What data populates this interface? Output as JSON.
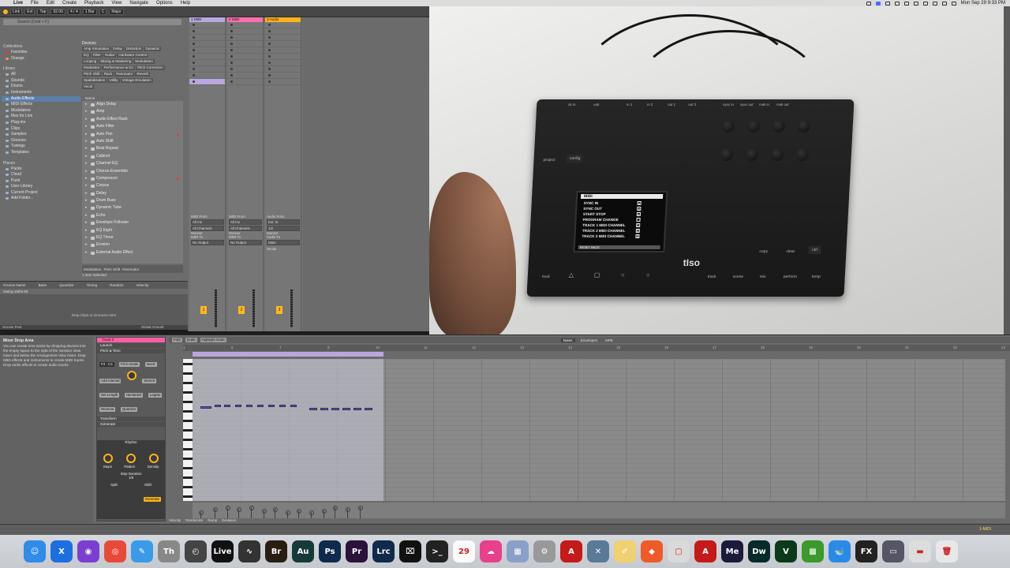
{
  "menubar": {
    "items": [
      "Live",
      "File",
      "Edit",
      "Create",
      "Playback",
      "View",
      "Navigate",
      "Options",
      "Help"
    ],
    "clock": "Mon Sep 29  9:33 PM"
  },
  "ctrlbar": {
    "link": "Link",
    "ext": "Ext",
    "tap": "Tap",
    "bpm": "92.00",
    "sig": "4 / 4",
    "bar": "1 Bar",
    "key": "C",
    "scale": "Major"
  },
  "browser": {
    "search_placeholder": "Search (Cmd + F)",
    "collections_h": "Collections",
    "collections": [
      {
        "label": "Favorites",
        "cls": "red"
      },
      {
        "label": "Orange",
        "cls": "orange"
      }
    ],
    "library_h": "Library",
    "library": [
      "All",
      "Sounds",
      "Drums",
      "Instruments",
      "Audio Effects",
      "MIDI Effects",
      "Modulators",
      "Max for Live",
      "Plug-ins",
      "Clips",
      "Samples",
      "Grooves",
      "Tunings",
      "Templates"
    ],
    "places_h": "Places",
    "places": [
      "Packs",
      "Cloud",
      "Push",
      "User Library",
      "Current Project",
      "Add Folder..."
    ],
    "devices_h": "Devices",
    "tags": [
      [
        "Amp Simulation",
        "Delay",
        "Distortion",
        "Dynamic"
      ],
      [
        "EQ",
        "Filter",
        "Guitar",
        "Hardware Control"
      ],
      [
        "Looping",
        "Mixing & Mastering",
        "Modulation"
      ],
      [
        "Modulator",
        "Performance & DJ",
        "Pitch Correction"
      ],
      [
        "Pitch Shift",
        "Rack",
        "Resonator",
        "Reverb"
      ],
      [
        "Spatialization",
        "Utility",
        "Vintage Emulation"
      ],
      [
        "Vocal"
      ]
    ],
    "name_h": "Name",
    "effects": [
      "Align Delay",
      "Amp",
      "Audio Effect Rack",
      "Auto Filter",
      "Auto Pan",
      "Auto Shift",
      "Beat Repeat",
      "Cabinet",
      "Channel EQ",
      "Chorus-Ensemble",
      "Compressor",
      "Corpus",
      "Delay",
      "Drum Buss",
      "Dynamic Tube",
      "Echo",
      "Envelope Follower",
      "EQ Eight",
      "EQ Three",
      "Erosion",
      "External Audio Effect"
    ],
    "footer_tags": [
      "Modulation",
      "Pitch Shift",
      "Resonator"
    ],
    "status": "1 item selected"
  },
  "groove": {
    "headers": [
      "Groove Name",
      "Base",
      "Quantize",
      "Timing",
      "Random",
      "Velocity"
    ],
    "row": "Swing 16ths 66",
    "drop": "Drop Clips or Grooves Here",
    "pool": "Groove Pool",
    "global": "Global Amount"
  },
  "session": {
    "tracks": [
      {
        "title": "1 MIDI",
        "color": "#b9a7de",
        "num": "1"
      },
      {
        "title": "2 MIDI",
        "color": "#ff6fb0",
        "num": "2"
      },
      {
        "title": "3 Audio",
        "color": "#ffb21a",
        "num": "3"
      }
    ],
    "io_labels": [
      "MIDI From",
      "All Ins",
      "All Channels",
      "Monitor",
      "MIDI To",
      "No Output"
    ],
    "audio_io": [
      "Audio From",
      "Ext. In",
      "1/2",
      "Monitor",
      "Audio To",
      "Main"
    ],
    "sends": "Sends"
  },
  "device_video": {
    "ports": [
      "dc in",
      "usb",
      "in 1",
      "in 2",
      "out 1",
      "out 2",
      "sync in",
      "sync out",
      "midi in",
      "midi out"
    ],
    "screen_title": "MIDI",
    "screen_lines": [
      {
        "label": "SYNC IN",
        "val": "x"
      },
      {
        "label": "SYNC OUT",
        "val": "x"
      },
      {
        "label": "START STOP",
        "val": "x"
      },
      {
        "label": "PROGRAM CHANGE",
        "val": ""
      },
      {
        "label": "TRACK 1 MIDI CHANNEL",
        "val": "1"
      },
      {
        "label": "TRACK 2 MIDI CHANNEL",
        "val": "2"
      },
      {
        "label": "TRACK 3 MIDI CHANNEL",
        "val": "3"
      }
    ],
    "screen_footer": "RESET          BACK",
    "buttons": [
      "project",
      "config",
      "mod",
      "track",
      "scene",
      "mix",
      "perform",
      "temp",
      "copy",
      "clear",
      "ctrl"
    ],
    "brand": "tIso"
  },
  "detail": {
    "info_title": "Mixer Drop Area",
    "info_body": "You can create new tracks by dropping devices into the empty space to the right of the Session View mixer and below the Arrangement View mixer. Drop MIDI effects and instruments to create MIDI tracks. Drop audio effects to create audio tracks.",
    "clip_name": "Track 0",
    "sections": [
      "Launch",
      "Pitch & Time"
    ],
    "pitch": "F3 - C4",
    "buttons": [
      "Fit to Scale",
      "Invert",
      "Add Interval",
      "Stretch",
      "Set Length",
      "Humanize",
      "Legato",
      "Reverse",
      "Quantize"
    ],
    "transform": "Transform",
    "generate": "Generate",
    "rhythm": "Rhythm",
    "knob_labels": [
      "Steps",
      "Pattern",
      "Density"
    ],
    "step_duration": "Step Duration",
    "step_val": "1/8",
    "gen_footer": [
      "Split",
      "Shift"
    ],
    "fold": "Fold",
    "scale": "Scale",
    "highlight": "Highlight Scale",
    "tabs": [
      "Notes",
      "Envelopes",
      "MPE"
    ],
    "ruler": [
      "1",
      "5",
      "7",
      "9",
      "10",
      "11",
      "12",
      "13",
      "14",
      "15",
      "16",
      "17",
      "18",
      "19",
      "20",
      "21",
      "22",
      "23"
    ],
    "vel_foot": [
      "Velocity",
      "Randomize",
      "Ramp",
      "Deviation"
    ],
    "generate_btn": "Generate",
    "status_right": "1-MIDI"
  },
  "dock": {
    "apps": [
      {
        "name": "finder",
        "label": "☺",
        "color": "#2f8ce8"
      },
      {
        "name": "xcode",
        "label": "X",
        "color": "#1b6fe0"
      },
      {
        "name": "obs",
        "label": "◉",
        "color": "#7a3fd0"
      },
      {
        "name": "chrome",
        "label": "◎",
        "color": "#e84a3a"
      },
      {
        "name": "stylus",
        "label": "✎",
        "color": "#3a9be8"
      },
      {
        "name": "type",
        "label": "Th",
        "color": "#888"
      },
      {
        "name": "capture",
        "label": "◴",
        "color": "#444"
      },
      {
        "name": "live",
        "label": "Live",
        "color": "#111"
      },
      {
        "name": "waves",
        "label": "∿",
        "color": "#333"
      },
      {
        "name": "bridge",
        "label": "Br",
        "color": "#2a1d12"
      },
      {
        "name": "audition",
        "label": "Au",
        "color": "#163a3a"
      },
      {
        "name": "photoshop",
        "label": "Ps",
        "color": "#0f2a4a"
      },
      {
        "name": "premiere",
        "label": "Pr",
        "color": "#2a123a"
      },
      {
        "name": "lightroom",
        "label": "Lrc",
        "color": "#0f2a4a"
      },
      {
        "name": "capcut",
        "label": "⌧",
        "color": "#111"
      },
      {
        "name": "terminal",
        "label": ">_",
        "color": "#222"
      },
      {
        "name": "calendar",
        "label": "29",
        "color": "#fafafa"
      },
      {
        "name": "creativecloud",
        "label": "☁",
        "color": "#e8408a"
      },
      {
        "name": "launchpad",
        "label": "▦",
        "color": "#8aa0c8"
      },
      {
        "name": "settings",
        "label": "⚙",
        "color": "#999"
      },
      {
        "name": "acrobat",
        "label": "A",
        "color": "#c41a1a"
      },
      {
        "name": "xquartz",
        "label": "✕",
        "color": "#5a7a9a"
      },
      {
        "name": "notes",
        "label": "✐",
        "color": "#f0d070"
      },
      {
        "name": "brave",
        "label": "◆",
        "color": "#f05a28"
      },
      {
        "name": "preview",
        "label": "▢",
        "color": "#dadada"
      },
      {
        "name": "acrobat2",
        "label": "A",
        "color": "#c41a1a"
      },
      {
        "name": "media-encoder",
        "label": "Me",
        "color": "#1a1a3a"
      },
      {
        "name": "dreamweaver",
        "label": "Dw",
        "color": "#072a2a"
      },
      {
        "name": "vectorworks",
        "label": "V",
        "color": "#0a3a1a"
      },
      {
        "name": "minecraft",
        "label": "▩",
        "color": "#3a9a2a"
      },
      {
        "name": "docker",
        "label": "🐋",
        "color": "#2a8ae8"
      },
      {
        "name": "fx",
        "label": "FX",
        "color": "#222"
      },
      {
        "name": "screen",
        "label": "▭",
        "color": "#556"
      },
      {
        "name": "storage",
        "label": "▬",
        "color": "#ddd"
      },
      {
        "name": "trash",
        "label": "🗑",
        "color": "#e8e8e8"
      }
    ]
  }
}
